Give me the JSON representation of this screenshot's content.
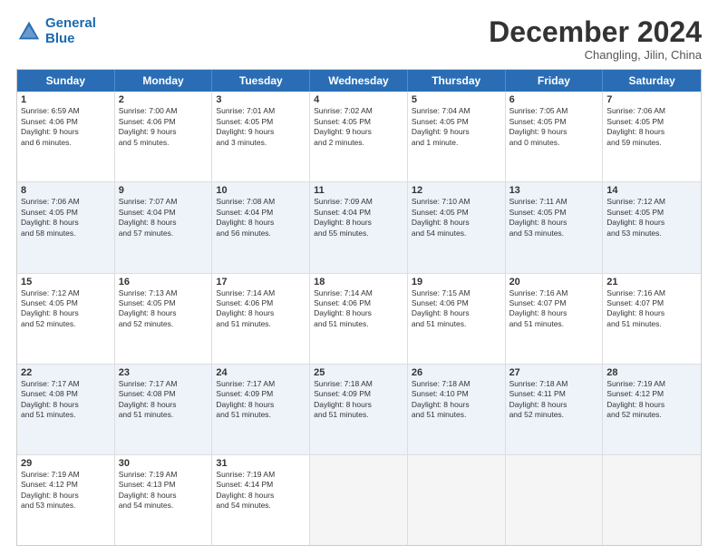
{
  "logo": {
    "line1": "General",
    "line2": "Blue"
  },
  "title": "December 2024",
  "subtitle": "Changling, Jilin, China",
  "days_of_week": [
    "Sunday",
    "Monday",
    "Tuesday",
    "Wednesday",
    "Thursday",
    "Friday",
    "Saturday"
  ],
  "rows": [
    [
      {
        "day": "1",
        "lines": [
          "Sunrise: 6:59 AM",
          "Sunset: 4:06 PM",
          "Daylight: 9 hours",
          "and 6 minutes."
        ]
      },
      {
        "day": "2",
        "lines": [
          "Sunrise: 7:00 AM",
          "Sunset: 4:06 PM",
          "Daylight: 9 hours",
          "and 5 minutes."
        ]
      },
      {
        "day": "3",
        "lines": [
          "Sunrise: 7:01 AM",
          "Sunset: 4:05 PM",
          "Daylight: 9 hours",
          "and 3 minutes."
        ]
      },
      {
        "day": "4",
        "lines": [
          "Sunrise: 7:02 AM",
          "Sunset: 4:05 PM",
          "Daylight: 9 hours",
          "and 2 minutes."
        ]
      },
      {
        "day": "5",
        "lines": [
          "Sunrise: 7:04 AM",
          "Sunset: 4:05 PM",
          "Daylight: 9 hours",
          "and 1 minute."
        ]
      },
      {
        "day": "6",
        "lines": [
          "Sunrise: 7:05 AM",
          "Sunset: 4:05 PM",
          "Daylight: 9 hours",
          "and 0 minutes."
        ]
      },
      {
        "day": "7",
        "lines": [
          "Sunrise: 7:06 AM",
          "Sunset: 4:05 PM",
          "Daylight: 8 hours",
          "and 59 minutes."
        ]
      }
    ],
    [
      {
        "day": "8",
        "lines": [
          "Sunrise: 7:06 AM",
          "Sunset: 4:05 PM",
          "Daylight: 8 hours",
          "and 58 minutes."
        ]
      },
      {
        "day": "9",
        "lines": [
          "Sunrise: 7:07 AM",
          "Sunset: 4:04 PM",
          "Daylight: 8 hours",
          "and 57 minutes."
        ]
      },
      {
        "day": "10",
        "lines": [
          "Sunrise: 7:08 AM",
          "Sunset: 4:04 PM",
          "Daylight: 8 hours",
          "and 56 minutes."
        ]
      },
      {
        "day": "11",
        "lines": [
          "Sunrise: 7:09 AM",
          "Sunset: 4:04 PM",
          "Daylight: 8 hours",
          "and 55 minutes."
        ]
      },
      {
        "day": "12",
        "lines": [
          "Sunrise: 7:10 AM",
          "Sunset: 4:05 PM",
          "Daylight: 8 hours",
          "and 54 minutes."
        ]
      },
      {
        "day": "13",
        "lines": [
          "Sunrise: 7:11 AM",
          "Sunset: 4:05 PM",
          "Daylight: 8 hours",
          "and 53 minutes."
        ]
      },
      {
        "day": "14",
        "lines": [
          "Sunrise: 7:12 AM",
          "Sunset: 4:05 PM",
          "Daylight: 8 hours",
          "and 53 minutes."
        ]
      }
    ],
    [
      {
        "day": "15",
        "lines": [
          "Sunrise: 7:12 AM",
          "Sunset: 4:05 PM",
          "Daylight: 8 hours",
          "and 52 minutes."
        ]
      },
      {
        "day": "16",
        "lines": [
          "Sunrise: 7:13 AM",
          "Sunset: 4:05 PM",
          "Daylight: 8 hours",
          "and 52 minutes."
        ]
      },
      {
        "day": "17",
        "lines": [
          "Sunrise: 7:14 AM",
          "Sunset: 4:06 PM",
          "Daylight: 8 hours",
          "and 51 minutes."
        ]
      },
      {
        "day": "18",
        "lines": [
          "Sunrise: 7:14 AM",
          "Sunset: 4:06 PM",
          "Daylight: 8 hours",
          "and 51 minutes."
        ]
      },
      {
        "day": "19",
        "lines": [
          "Sunrise: 7:15 AM",
          "Sunset: 4:06 PM",
          "Daylight: 8 hours",
          "and 51 minutes."
        ]
      },
      {
        "day": "20",
        "lines": [
          "Sunrise: 7:16 AM",
          "Sunset: 4:07 PM",
          "Daylight: 8 hours",
          "and 51 minutes."
        ]
      },
      {
        "day": "21",
        "lines": [
          "Sunrise: 7:16 AM",
          "Sunset: 4:07 PM",
          "Daylight: 8 hours",
          "and 51 minutes."
        ]
      }
    ],
    [
      {
        "day": "22",
        "lines": [
          "Sunrise: 7:17 AM",
          "Sunset: 4:08 PM",
          "Daylight: 8 hours",
          "and 51 minutes."
        ]
      },
      {
        "day": "23",
        "lines": [
          "Sunrise: 7:17 AM",
          "Sunset: 4:08 PM",
          "Daylight: 8 hours",
          "and 51 minutes."
        ]
      },
      {
        "day": "24",
        "lines": [
          "Sunrise: 7:17 AM",
          "Sunset: 4:09 PM",
          "Daylight: 8 hours",
          "and 51 minutes."
        ]
      },
      {
        "day": "25",
        "lines": [
          "Sunrise: 7:18 AM",
          "Sunset: 4:09 PM",
          "Daylight: 8 hours",
          "and 51 minutes."
        ]
      },
      {
        "day": "26",
        "lines": [
          "Sunrise: 7:18 AM",
          "Sunset: 4:10 PM",
          "Daylight: 8 hours",
          "and 51 minutes."
        ]
      },
      {
        "day": "27",
        "lines": [
          "Sunrise: 7:18 AM",
          "Sunset: 4:11 PM",
          "Daylight: 8 hours",
          "and 52 minutes."
        ]
      },
      {
        "day": "28",
        "lines": [
          "Sunrise: 7:19 AM",
          "Sunset: 4:12 PM",
          "Daylight: 8 hours",
          "and 52 minutes."
        ]
      }
    ],
    [
      {
        "day": "29",
        "lines": [
          "Sunrise: 7:19 AM",
          "Sunset: 4:12 PM",
          "Daylight: 8 hours",
          "and 53 minutes."
        ]
      },
      {
        "day": "30",
        "lines": [
          "Sunrise: 7:19 AM",
          "Sunset: 4:13 PM",
          "Daylight: 8 hours",
          "and 54 minutes."
        ]
      },
      {
        "day": "31",
        "lines": [
          "Sunrise: 7:19 AM",
          "Sunset: 4:14 PM",
          "Daylight: 8 hours",
          "and 54 minutes."
        ]
      },
      {
        "day": "",
        "lines": []
      },
      {
        "day": "",
        "lines": []
      },
      {
        "day": "",
        "lines": []
      },
      {
        "day": "",
        "lines": []
      }
    ]
  ]
}
